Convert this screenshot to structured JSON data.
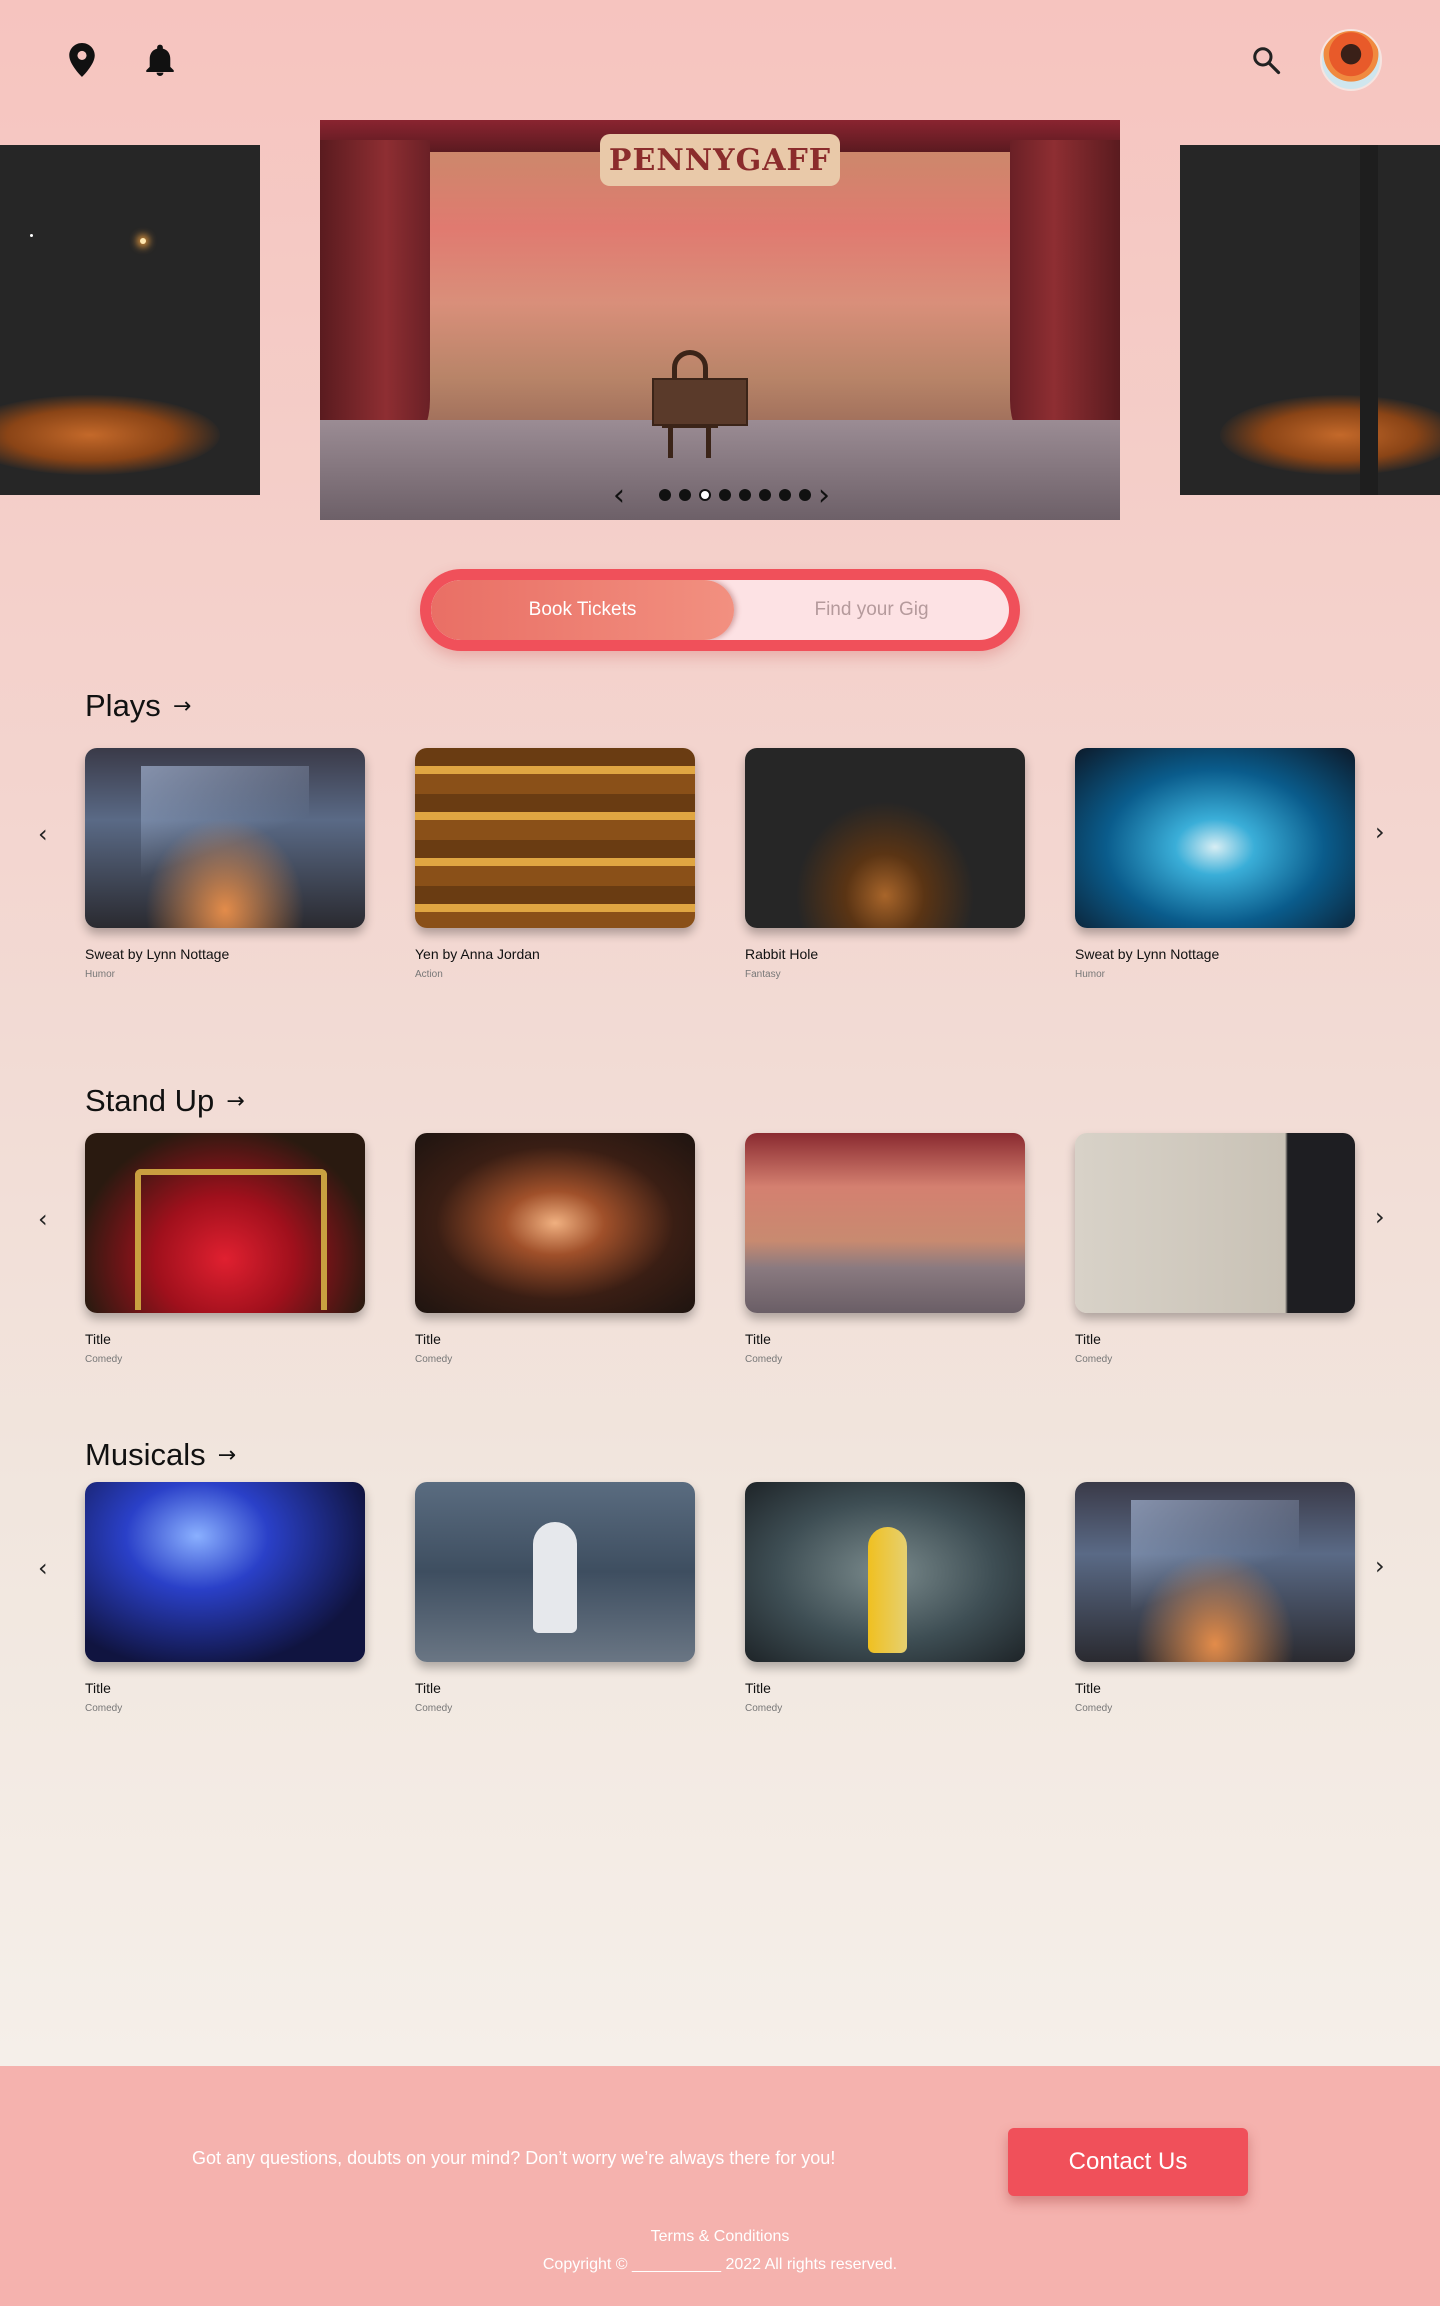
{
  "header": {
    "icons": [
      "location-pin-icon",
      "bell-icon",
      "search-icon"
    ]
  },
  "hero": {
    "banner_text": "PENNYGAFF",
    "slide_count": 8,
    "active_slide": 2,
    "prev_symbol": "‹",
    "next_symbol": "›"
  },
  "toggle": {
    "active_label": "Book Tickets",
    "inactive_label": "Find your Gig"
  },
  "sections": [
    {
      "title": "Plays",
      "items": [
        {
          "title": "Sweat by Lynn Nottage",
          "genre": "Humor"
        },
        {
          "title": "Yen by Anna Jordan",
          "genre": "Action"
        },
        {
          "title": "Rabbit Hole",
          "genre": "Fantasy"
        },
        {
          "title": "Sweat by Lynn Nottage",
          "genre": "Humor"
        }
      ]
    },
    {
      "title": "Stand Up",
      "items": [
        {
          "title": "Title",
          "genre": "Comedy"
        },
        {
          "title": "Title",
          "genre": "Comedy"
        },
        {
          "title": "Title",
          "genre": "Comedy"
        },
        {
          "title": "Title",
          "genre": "Comedy"
        }
      ]
    },
    {
      "title": "Musicals",
      "items": [
        {
          "title": "Title",
          "genre": "Comedy"
        },
        {
          "title": "Title",
          "genre": "Comedy"
        },
        {
          "title": "Title",
          "genre": "Comedy"
        },
        {
          "title": "Title",
          "genre": "Comedy"
        }
      ]
    }
  ],
  "row_arrows": {
    "prev": "‹",
    "next": "›"
  },
  "section_arrow": "→",
  "footer": {
    "message": "Got any questions, doubts on your mind? Don’t worry we’re always there for you!",
    "contact_label": "Contact Us",
    "terms_label": "Terms & Conditions",
    "copyright": "Copyright © __________ 2022 All rights reserved."
  },
  "colors": {
    "accent": "#f0505a",
    "footer_bg": "#f5b2ae",
    "toggle_active": "#e96f65"
  }
}
